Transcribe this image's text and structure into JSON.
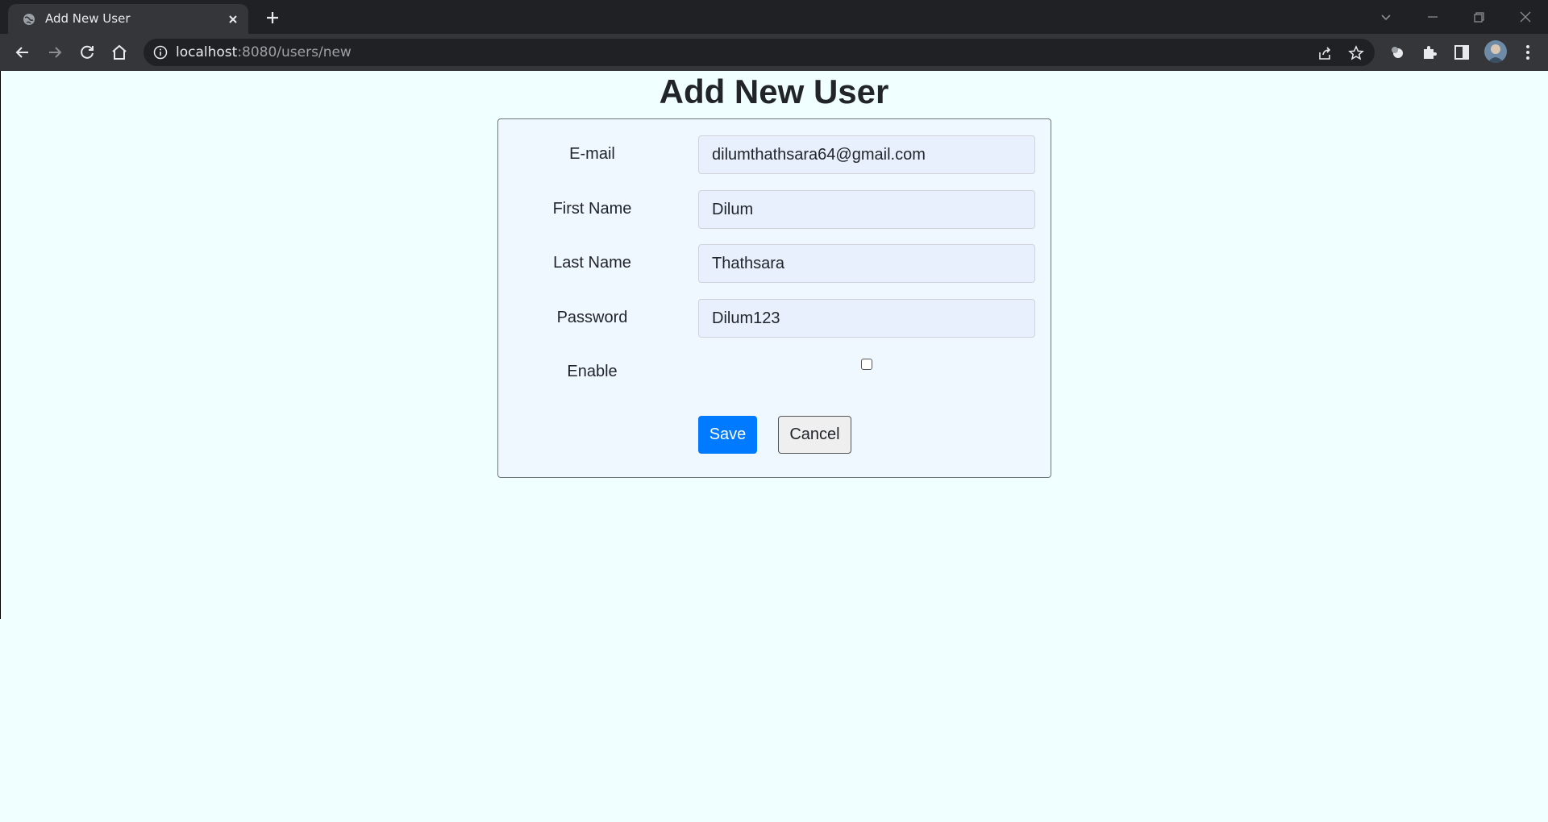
{
  "browser": {
    "tab_title": "Add New User",
    "url_host": "localhost",
    "url_path": ":8080/users/new"
  },
  "page": {
    "title": "Add New User",
    "form": {
      "email_label": "E-mail",
      "email_value": "dilumthathsara64@gmail.com",
      "first_name_label": "First Name",
      "first_name_value": "Dilum",
      "last_name_label": "Last Name",
      "last_name_value": "Thathsara",
      "password_label": "Password",
      "password_value": "Dilum123",
      "enable_label": "Enable",
      "enable_checked": false,
      "save_label": "Save",
      "cancel_label": "Cancel"
    }
  },
  "colors": {
    "page_background": "#f0ffff",
    "form_background": "#f0f8ff",
    "save_button": "#007bff"
  }
}
